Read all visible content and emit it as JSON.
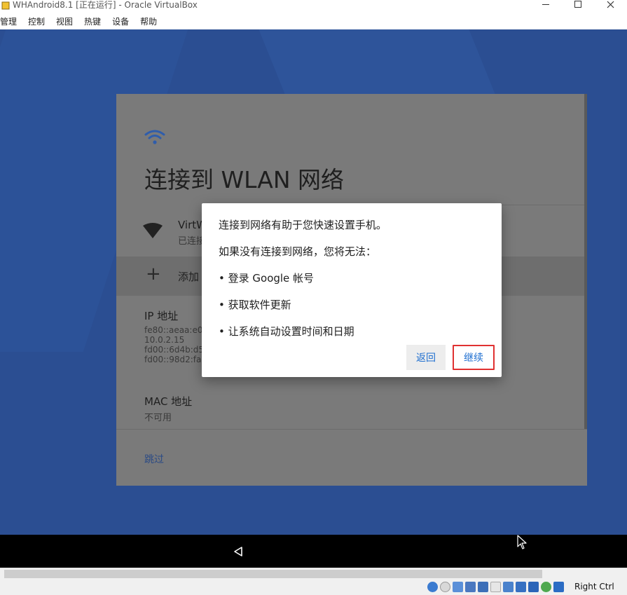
{
  "window": {
    "title": "WHAndroid8.1 [正在运行] - Oracle VirtualBox",
    "menu": [
      "管理",
      "控制",
      "视图",
      "热键",
      "设备",
      "帮助"
    ]
  },
  "setup": {
    "title": "连接到 WLAN 网络",
    "network_name": "VirtW",
    "network_status": "已连接",
    "add_network_label": "添加",
    "ip_heading": "IP 地址",
    "ip_addresses": [
      "fe80::aeaa:e0",
      "10.0.2.15",
      "fd00::6d4b:d5",
      "fd00::98d2:fa"
    ],
    "mac_heading": "MAC 地址",
    "mac_value": "不可用",
    "skip_label": "跳过"
  },
  "dialog": {
    "line1": "连接到网络有助于您快速设置手机。",
    "line2": "如果没有连接到网络，您将无法：",
    "bullets": [
      "登录 Google 帐号",
      "获取软件更新",
      "让系统自动设置时间和日期"
    ],
    "back_label": "返回",
    "continue_label": "继续"
  },
  "statusbar": {
    "host_key": "Right Ctrl"
  },
  "colors": {
    "guest_background": "#2b4e92",
    "dialog_button_text": "#1f6fd0",
    "highlight_border": "#e03131"
  }
}
